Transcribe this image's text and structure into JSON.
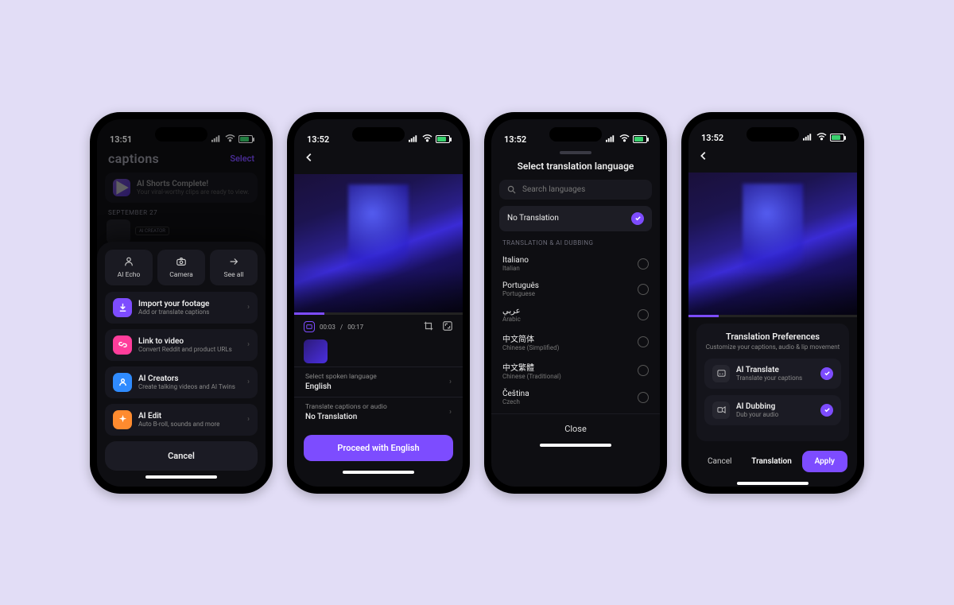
{
  "statusbar": {
    "time1": "13:51",
    "time2": "13:52",
    "time3": "13:52",
    "time4": "13:52"
  },
  "phone1": {
    "logo": "captions",
    "select": "Select",
    "banner_title": "AI Shorts Complete!",
    "banner_sub": "Your viral-worthy clips are ready to view.",
    "date": "SEPTEMBER 27",
    "thumb_tag": "AI CREATOR",
    "quick": [
      {
        "label": "AI Echo"
      },
      {
        "label": "Camera"
      },
      {
        "label": "See all"
      }
    ],
    "items": [
      {
        "title": "Import your footage",
        "sub": "Add or translate captions",
        "color": "#7d4cff"
      },
      {
        "title": "Link to video",
        "sub": "Convert Reddit and product URLs",
        "color": "#ff3d9b"
      },
      {
        "title": "AI Creators",
        "sub": "Create talking videos and AI Twins",
        "color": "#2f8bff"
      },
      {
        "title": "AI Edit",
        "sub": "Auto B-roll, sounds and more",
        "color": "#ff8b2f"
      }
    ],
    "cancel": "Cancel"
  },
  "phone2": {
    "time_current": "00:03",
    "time_total": "00:17",
    "lang_label": "Select spoken language",
    "lang_value": "English",
    "trans_label": "Translate captions or audio",
    "trans_value": "No Translation",
    "proceed": "Proceed with English"
  },
  "phone3": {
    "title": "Select translation language",
    "search_placeholder": "Search languages",
    "selected": "No Translation",
    "section": "TRANSLATION & AI DUBBING",
    "langs": [
      {
        "name": "Italiano",
        "sub": "Italian"
      },
      {
        "name": "Português",
        "sub": "Portuguese"
      },
      {
        "name": "عربي",
        "sub": "Arabic"
      },
      {
        "name": "中文简体",
        "sub": "Chinese (Simplified)"
      },
      {
        "name": "中文繁體",
        "sub": "Chinese (Traditional)"
      },
      {
        "name": "Čeština",
        "sub": "Czech"
      }
    ],
    "close": "Close"
  },
  "phone4": {
    "box_title": "Translation Preferences",
    "box_sub": "Customize your captions, audio & lip movement",
    "rows": [
      {
        "title": "AI Translate",
        "sub": "Translate your captions"
      },
      {
        "title": "AI Dubbing",
        "sub": "Dub your audio"
      }
    ],
    "cancel": "Cancel",
    "translation": "Translation",
    "apply": "Apply"
  }
}
